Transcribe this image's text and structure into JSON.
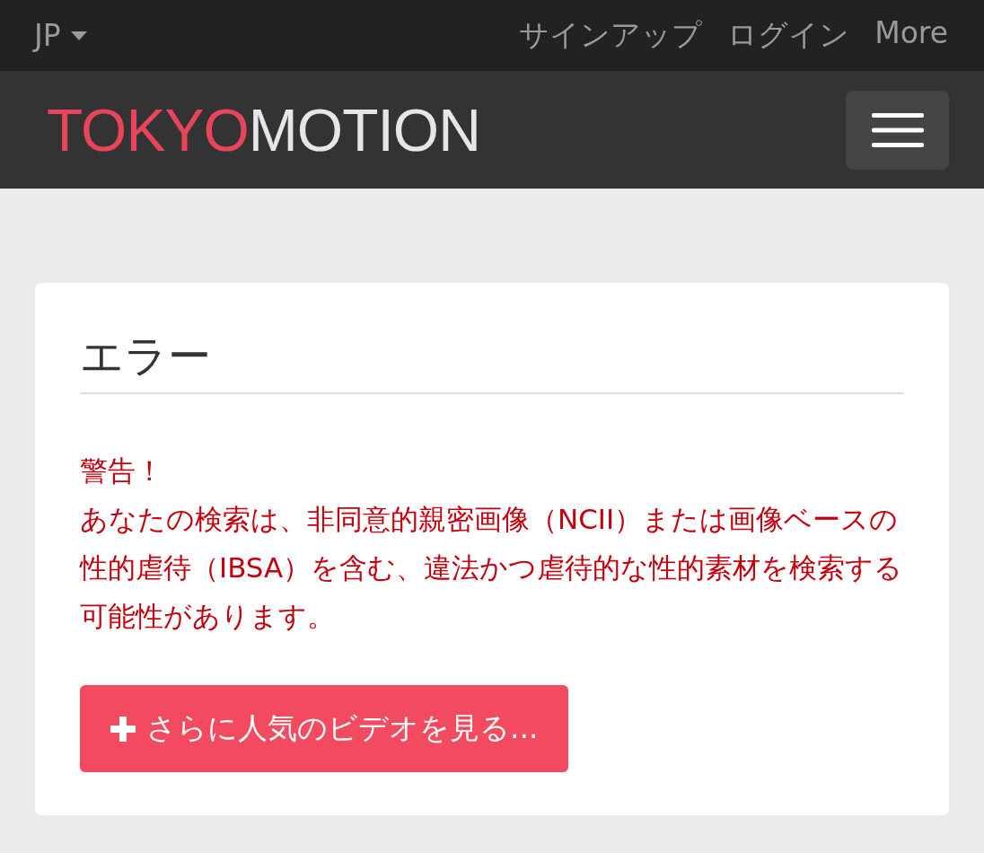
{
  "top_bar": {
    "language": "JP",
    "links": [
      "サインアップ",
      "ログイン",
      "More"
    ]
  },
  "navbar": {
    "logo": [
      "TOKYO",
      "MOTION"
    ]
  },
  "card": {
    "title": "エラー",
    "warning_title": "警告！",
    "warning_text": "あなたの検索は、非同意的親密画像（NCII）または画像ベースの性的虐待（IBSA）を含む、違法かつ虐待的な性的素材を検索する可能性があります。",
    "button": "さらに人気のビデオを見る..."
  }
}
